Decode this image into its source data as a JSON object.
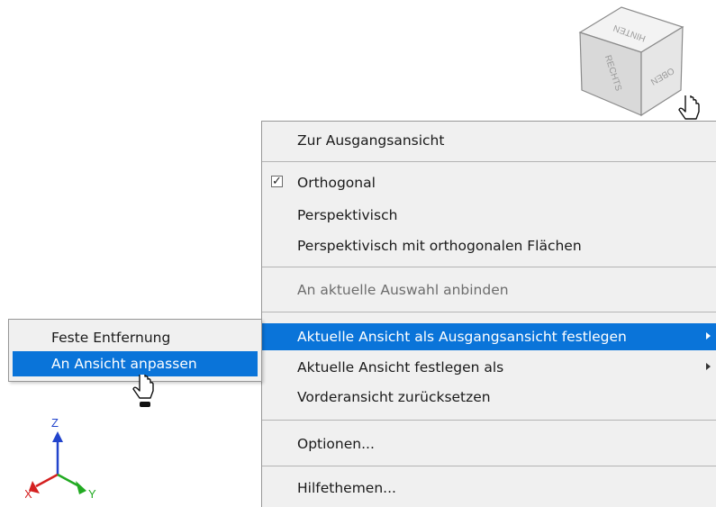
{
  "viewcube": {
    "faces": {
      "top": "HINTEN",
      "left": "RECHTS",
      "right": "OBEN"
    }
  },
  "context_menu": {
    "items": [
      {
        "label": "Zur Ausgangsansicht"
      },
      {
        "label": "Orthogonal",
        "checked": true
      },
      {
        "label": "Perspektivisch"
      },
      {
        "label": "Perspektivisch mit orthogonalen Flächen"
      },
      {
        "label": "An aktuelle Auswahl anbinden",
        "disabled": true
      },
      {
        "label": "Aktuelle Ansicht als Ausgangsansicht festlegen",
        "highlighted": true,
        "has_submenu": true
      },
      {
        "label": "Aktuelle Ansicht festlegen als",
        "has_submenu": true
      },
      {
        "label": "Vorderansicht zurücksetzen"
      },
      {
        "label": "Optionen..."
      },
      {
        "label": "Hilfethemen..."
      }
    ]
  },
  "submenu": {
    "items": [
      {
        "label": "Feste Entfernung"
      },
      {
        "label": "An Ansicht anpassen",
        "highlighted": true
      }
    ]
  },
  "axis": {
    "x": "X",
    "y": "Y",
    "z": "Z"
  },
  "colors": {
    "highlight": "#0a74d9",
    "menu_bg": "#f0f0f0",
    "x_axis": "#d42020",
    "y_axis": "#22aa22",
    "z_axis": "#2244cc"
  }
}
